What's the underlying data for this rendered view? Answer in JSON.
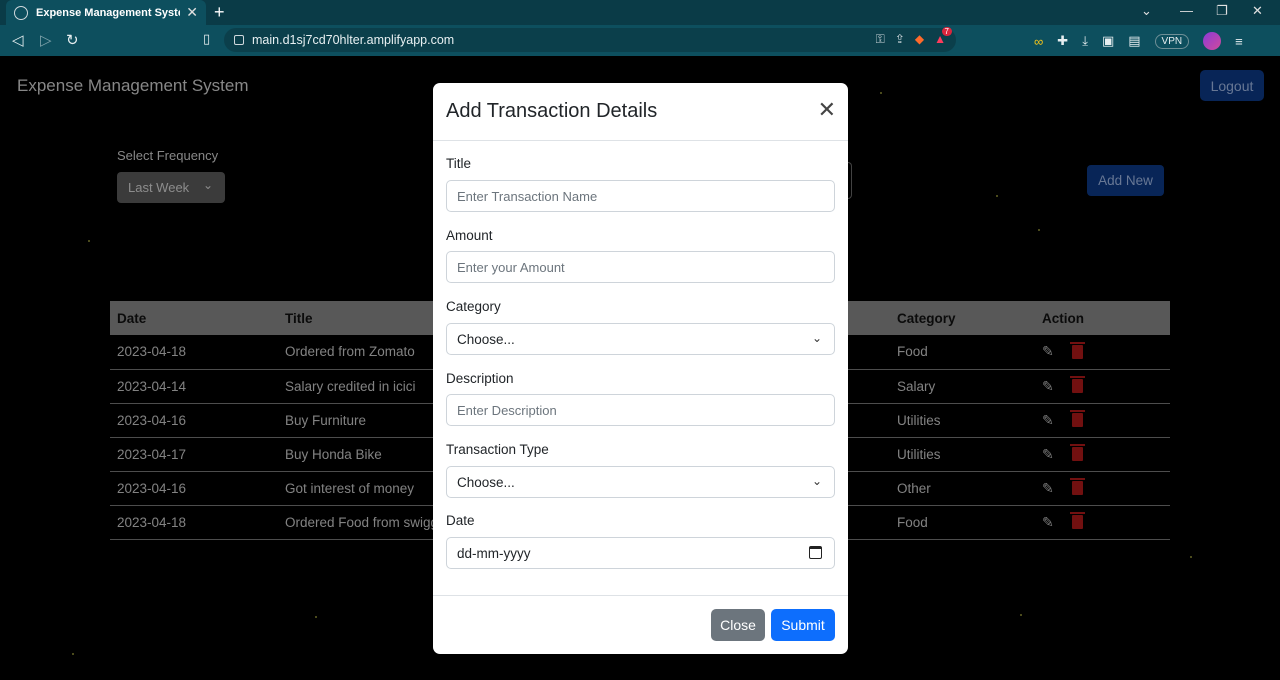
{
  "browser": {
    "tab_title": "Expense Management System",
    "tab_close": "✕",
    "new_tab": "+",
    "url": "main.d1sj7cd70hlter.amplifyapp.com",
    "alert_count": "7",
    "vpn_label": "VPN"
  },
  "app": {
    "title": "Expense Management System",
    "logout_label": "Logout",
    "frequency_label": "Select Frequency",
    "frequency_value": "Last Week",
    "add_new_label": "Add New"
  },
  "table": {
    "headers": [
      "Date",
      "Title",
      "Category",
      "Action"
    ],
    "rows": [
      {
        "date": "2023-04-18",
        "title": "Ordered from Zomato",
        "category": "Food"
      },
      {
        "date": "2023-04-14",
        "title": "Salary credited in icici",
        "category": "Salary"
      },
      {
        "date": "2023-04-16",
        "title": "Buy Furniture",
        "category": "Utilities"
      },
      {
        "date": "2023-04-17",
        "title": "Buy Honda Bike",
        "category": "Utilities"
      },
      {
        "date": "2023-04-16",
        "title": "Got interest of money",
        "category": "Other"
      },
      {
        "date": "2023-04-18",
        "title": "Ordered Food from swigg",
        "category": "Food"
      }
    ]
  },
  "modal": {
    "title": "Add Transaction Details",
    "fields": {
      "title_label": "Title",
      "title_placeholder": "Enter Transaction Name",
      "amount_label": "Amount",
      "amount_placeholder": "Enter your Amount",
      "category_label": "Category",
      "category_value": "Choose...",
      "description_label": "Description",
      "description_placeholder": "Enter Description",
      "type_label": "Transaction Type",
      "type_value": "Choose...",
      "date_label": "Date",
      "date_placeholder": "dd-mm-yyyy"
    },
    "close_label": "Close",
    "submit_label": "Submit"
  },
  "colors": {
    "primary": "#0d6efd",
    "secondary": "#6c757d",
    "browser_chrome": "#0d4f5e",
    "delete_red": "#b01a1a"
  }
}
